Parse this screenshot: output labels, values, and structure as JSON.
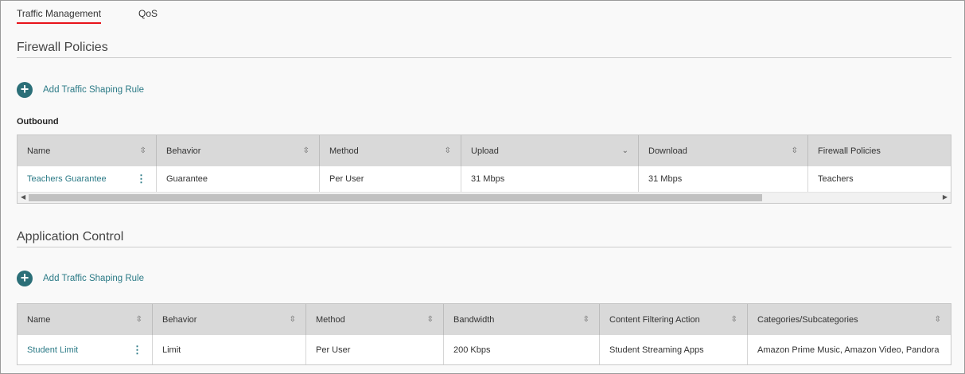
{
  "tabs": [
    {
      "label": "Traffic Management",
      "active": true
    },
    {
      "label": "QoS",
      "active": false
    }
  ],
  "sections": {
    "firewall": {
      "title": "Firewall Policies",
      "add_label": "Add Traffic Shaping Rule",
      "subheading": "Outbound",
      "columns": [
        "Name",
        "Behavior",
        "Method",
        "Upload",
        "Download",
        "Firewall Policies"
      ],
      "rows": [
        {
          "name": "Teachers Guarantee",
          "behavior": "Guarantee",
          "method": "Per User",
          "upload": "31 Mbps",
          "download": "31 Mbps",
          "policies": "Teachers"
        }
      ]
    },
    "app": {
      "title": "Application Control",
      "add_label": "Add Traffic Shaping Rule",
      "columns": [
        "Name",
        "Behavior",
        "Method",
        "Bandwidth",
        "Content Filtering Action",
        "Categories/Subcategories"
      ],
      "rows": [
        {
          "name": "Student Limit",
          "behavior": "Limit",
          "method": "Per User",
          "bandwidth": "200 Kbps",
          "action": "Student Streaming Apps",
          "categories": "Amazon Prime Music, Amazon Video, Pandora"
        }
      ]
    }
  },
  "colors": {
    "accent": "#2b7a86",
    "tab_underline": "#e8141b"
  }
}
